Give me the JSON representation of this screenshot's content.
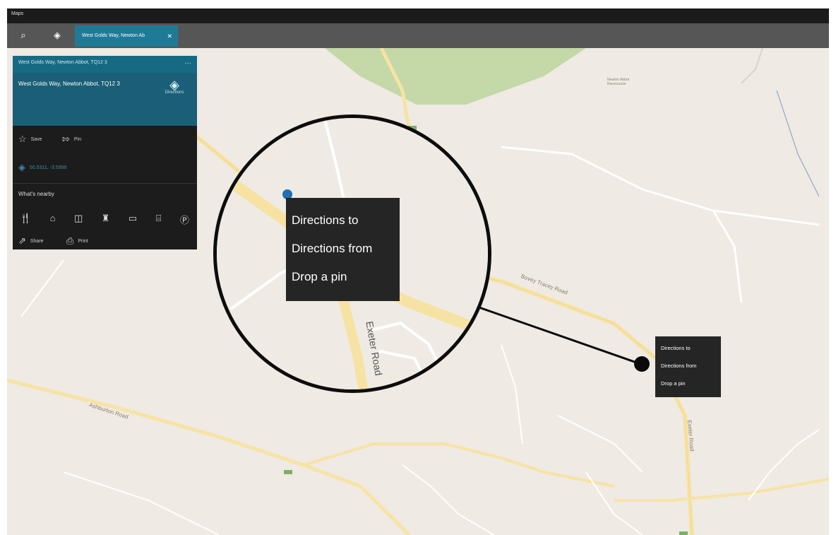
{
  "window": {
    "title": "Maps"
  },
  "toolbar": {
    "search_icon": "search-icon",
    "directions_icon": "directions-icon",
    "tab_label": "West Golds Way, Newton Ab",
    "tab_close": "✕"
  },
  "panel": {
    "header_title": "West Golds Way, Newton Abbot, TQ12 3",
    "header_more": "…",
    "address": "West Golds Way, Newton Abbot, TQ12 3",
    "directions_label": "Directions",
    "save_label": "Save",
    "pin_label": "Pin",
    "coordinates": "50.5311, -3.5999",
    "nearby_title": "What's nearby",
    "nearby_icons": [
      "restaurant-icon",
      "hotel-icon",
      "shopping-icon",
      "attractions-icon",
      "museum-icon",
      "bank-icon",
      "parking-icon"
    ],
    "share_label": "Share",
    "print_label": "Print"
  },
  "map": {
    "roads": [
      "Bovey Tracey Road",
      "Ashburton Road",
      "Exeter Road",
      "Exeter Road"
    ],
    "colors": {
      "land": "#efeae3",
      "park": "#b8d49a",
      "major_road": "#f6e4a6",
      "minor_road": "#ffffff"
    }
  },
  "context_menu_large": {
    "items": [
      "Directions to",
      "Directions from",
      "Drop a pin"
    ]
  },
  "context_menu_small": {
    "items": [
      "Directions to",
      "Directions from",
      "Drop a pin"
    ]
  }
}
